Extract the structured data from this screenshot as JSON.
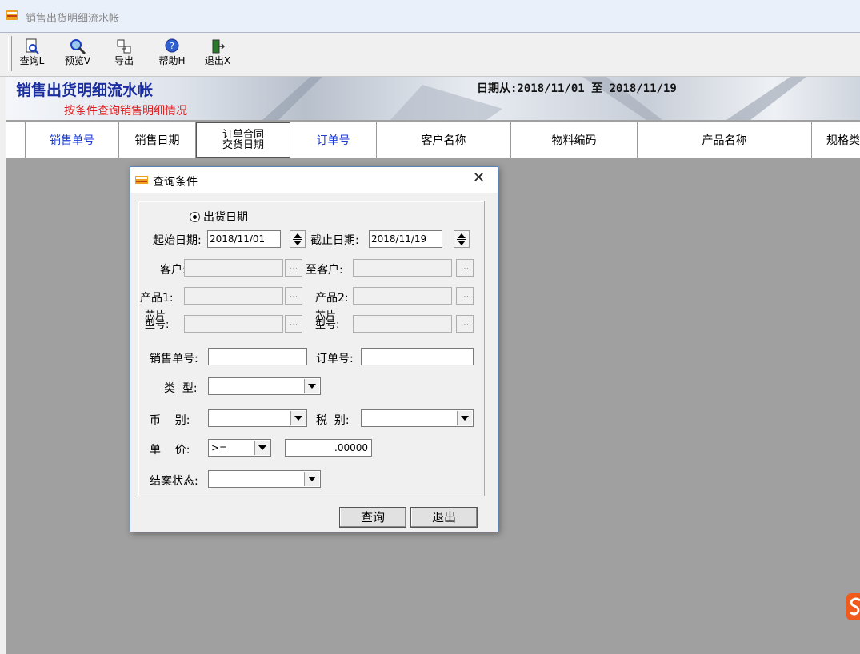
{
  "window": {
    "title": "销售出货明细流水帐"
  },
  "toolbar": {
    "buttons": [
      {
        "label": "查询L",
        "icon": "query-doc-icon"
      },
      {
        "label": "预览V",
        "icon": "magnifier-icon"
      },
      {
        "label": "导出",
        "icon": "export-icon"
      },
      {
        "label": "帮助H",
        "icon": "help-icon"
      },
      {
        "label": "退出X",
        "icon": "exit-door-icon"
      }
    ]
  },
  "banner": {
    "title": "销售出货明细流水帐",
    "subtitle": "按条件查询销售明细情况",
    "date_range": "日期从:2018/11/01 至 2018/11/19"
  },
  "table": {
    "columns": [
      "销售单号",
      "销售日期",
      "订单合同交货日期",
      "订单号",
      "客户名称",
      "物料编码",
      "产品名称",
      "规格类"
    ],
    "col3_line1": "订单合同",
    "col3_line2": "交货日期"
  },
  "dialog": {
    "title": "查询条件",
    "close": "✕",
    "radio_label": "出货日期",
    "start_date_label": "起始日期:",
    "start_date_value": "2018/11/01",
    "end_date_label": "截止日期:",
    "end_date_value": "2018/11/19",
    "customer_label": "客户:",
    "to_customer_label": "至客户:",
    "product1_label": "产品1:",
    "product2_label": "产品2:",
    "chip_label_top": "芯片",
    "chip_label_bottom": "型号:",
    "ellipsis": "...",
    "sales_no_label": "销售单号:",
    "order_no_label": "订单号:",
    "type_label": "类  型:",
    "currency_label": "币    别:",
    "tax_label": "税  别:",
    "price_label": "单    价:",
    "price_operator": ">=",
    "price_value": ".00000",
    "close_status_label": "结案状态:",
    "query_button": "查询",
    "exit_button": "退出"
  }
}
